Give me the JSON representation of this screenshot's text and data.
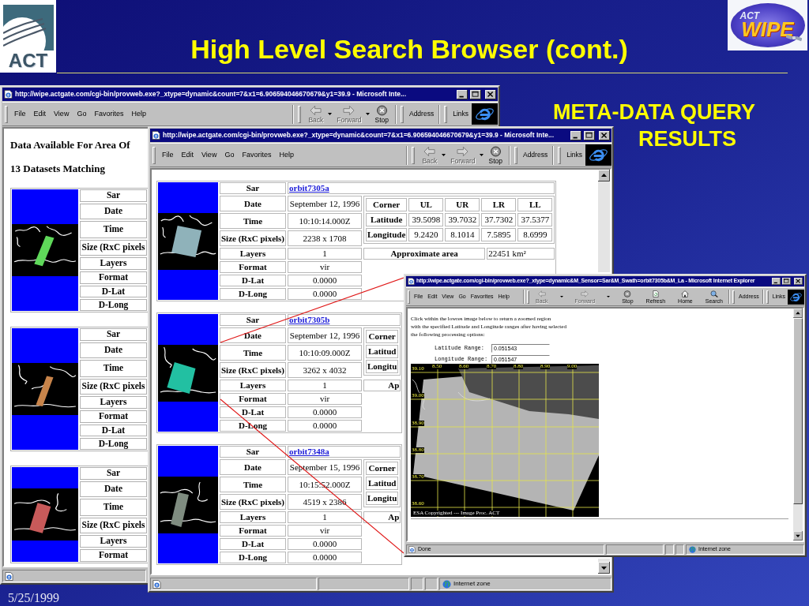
{
  "slide": {
    "logo_left": "ACT",
    "title": "High Level Search Browser (cont.)",
    "logo_right": {
      "small": "ACT",
      "large": "WIPE"
    },
    "caption_lines": [
      "META-DATA QUERY",
      "RESULTS"
    ],
    "date": "5/25/1999"
  },
  "windows": [
    {
      "kind": "dataset-list",
      "title": "http://wipe.actgate.com/cgi-bin/provweb.exe?_xtype=dynamic&count=7&x1=6.906594046670679&y1=39.9 - Microsoft Inte...",
      "menu": [
        "File",
        "Edit",
        "View",
        "Go",
        "Favorites",
        "Help"
      ],
      "toolbar": [
        {
          "kind": "back",
          "label": "Back",
          "disabled": true
        },
        {
          "kind": "forward",
          "label": "Forward",
          "disabled": true
        },
        {
          "kind": "stop",
          "label": "Stop",
          "disabled": false
        }
      ],
      "address_label": "Address",
      "links_label": "Links",
      "heading": "Data Available For Area Of",
      "count": "13 Datasets Matching",
      "datasets": [
        {
          "color": "#5fd85a",
          "fields": [
            "Sar",
            "Date",
            "Time",
            "Size (RxC pixels",
            "Layers",
            "Format",
            "D-Lat",
            "D-Long"
          ]
        },
        {
          "color": "#c8844a",
          "fields": [
            "Sar",
            "Date",
            "Time",
            "Size (RxC pixels",
            "Layers",
            "Format",
            "D-Lat",
            "D-Long"
          ]
        },
        {
          "color": "#c85a5a",
          "fields": [
            "Sar",
            "Date",
            "Time",
            "Size (RxC pixels",
            "Layers",
            "Format"
          ]
        }
      ]
    },
    {
      "kind": "dataset-detail",
      "title": "http://wipe.actgate.com/cgi-bin/provweb.exe?_xtype=dynamic&count=7&x1=6.906594046670679&y1=39.9 - Microsoft Inte...",
      "menu": [
        "File",
        "Edit",
        "View",
        "Go",
        "Favorites",
        "Help"
      ],
      "toolbar": [
        {
          "kind": "back",
          "label": "Back",
          "disabled": true
        },
        {
          "kind": "forward",
          "label": "Forward",
          "disabled": true
        },
        {
          "kind": "stop",
          "label": "Stop",
          "disabled": false
        }
      ],
      "address_label": "Address",
      "links_label": "Links",
      "datasets": [
        {
          "color": "#8fb2ba",
          "title_row": {
            "label": "Sar",
            "link": "orbit7305a"
          },
          "rows": [
            {
              "label": "Date",
              "value": "September 12, 1996"
            },
            {
              "label": "Time",
              "value": "10:10:14.000Z"
            },
            {
              "label": "Size (RxC pixels)",
              "value": "2238 x 1708"
            },
            {
              "label": "Layers",
              "value": "1"
            },
            {
              "label": "Format",
              "value": "vir"
            },
            {
              "label": "D-Lat",
              "value": "0.0000"
            },
            {
              "label": "D-Long",
              "value": "0.0000"
            }
          ],
          "corners": {
            "columns": [
              "Corner",
              "UL",
              "UR",
              "LR",
              "LL"
            ],
            "rows": [
              {
                "label": "Latitude",
                "values": [
                  "39.5098",
                  "39.7032",
                  "37.7302",
                  "37.5377"
                ]
              },
              {
                "label": "Longitude",
                "values": [
                  "9.2420",
                  "8.1014",
                  "7.5895",
                  "8.6999"
                ]
              }
            ]
          },
          "area": {
            "label": "Approximate area",
            "value": "22451 km²"
          }
        },
        {
          "color": "#22c0a2",
          "title_row": {
            "label": "Sar",
            "link": "orbit7305b"
          },
          "rows": [
            {
              "label": "Date",
              "value": "September 12, 1996"
            },
            {
              "label": "Time",
              "value": "10:10:09.000Z"
            },
            {
              "label": "Size (RxC pixels)",
              "value": "3262 x 4032"
            },
            {
              "label": "Layers",
              "value": "1"
            },
            {
              "label": "Format",
              "value": "vir"
            },
            {
              "label": "D-Lat",
              "value": "0.0000"
            },
            {
              "label": "D-Long",
              "value": "0.0000"
            }
          ],
          "corners": {
            "columns": [
              "Corner"
            ],
            "rows": [
              {
                "label": "Latitud"
              },
              {
                "label": "Longitu"
              }
            ]
          },
          "area": {
            "label": "Ap"
          }
        },
        {
          "color": "#7f8c80",
          "title_row": {
            "label": "Sar",
            "link": "orbit7348a"
          },
          "rows": [
            {
              "label": "Date",
              "value": "September 15, 1996"
            },
            {
              "label": "Time",
              "value": "10:15:52.000Z"
            },
            {
              "label": "Size (RxC pixels)",
              "value": "4519 x 2386"
            },
            {
              "label": "Layers",
              "value": "1"
            },
            {
              "label": "Format",
              "value": "vir"
            },
            {
              "label": "D-Lat",
              "value": "0.0000"
            },
            {
              "label": "D-Long",
              "value": "0.0000"
            }
          ],
          "corners": {
            "columns": [
              "Corner"
            ],
            "rows": [
              {
                "label": "Latitud"
              },
              {
                "label": "Longitu"
              }
            ]
          },
          "area": {
            "label": "Ap"
          }
        }
      ],
      "status_zone": "Internet zone"
    },
    {
      "kind": "zoom-view",
      "title": "http://wipe.actgate.com/cgi-bin/provweb.exe?_xtype=dynamic&M_Sensor=Sar&M_Swath=orbit7305b&M_La - Microsoft Internet Explorer",
      "menu": [
        "File",
        "Edit",
        "View",
        "Go",
        "Favorites",
        "Help"
      ],
      "toolbar": [
        {
          "kind": "back",
          "label": "Back",
          "disabled": true
        },
        {
          "kind": "forward",
          "label": "Forward",
          "disabled": true
        },
        {
          "kind": "stop",
          "label": "Stop",
          "disabled": false
        },
        {
          "kind": "refresh",
          "label": "Refresh",
          "disabled": false
        },
        {
          "kind": "home",
          "label": "Home",
          "disabled": false
        },
        {
          "kind": "search",
          "label": "Search",
          "disabled": false
        }
      ],
      "address_label": "Address",
      "links_label": "Links",
      "instructions": "Click within the lowres image below to return a zoomed region\nwith the specified Latitude and Longitude ranges after having selected\nthe following processing options:",
      "fields": [
        {
          "label": "Latitude Range:",
          "value": "0.051543"
        },
        {
          "label": "Longitude Range:",
          "value": "0.051547"
        }
      ],
      "image": {
        "lon_labels": [
          "8.50",
          "8.60",
          "8.70",
          "8.80",
          "8.90",
          "9.00"
        ],
        "lat_labels": [
          "39.10",
          "39.00",
          "38.90",
          "38.80",
          "38.70",
          "38.60"
        ],
        "credit": "ESA Copyrighted --- Image Proc. ACT"
      },
      "status": "Done",
      "status_zone": "Internet zone"
    }
  ]
}
